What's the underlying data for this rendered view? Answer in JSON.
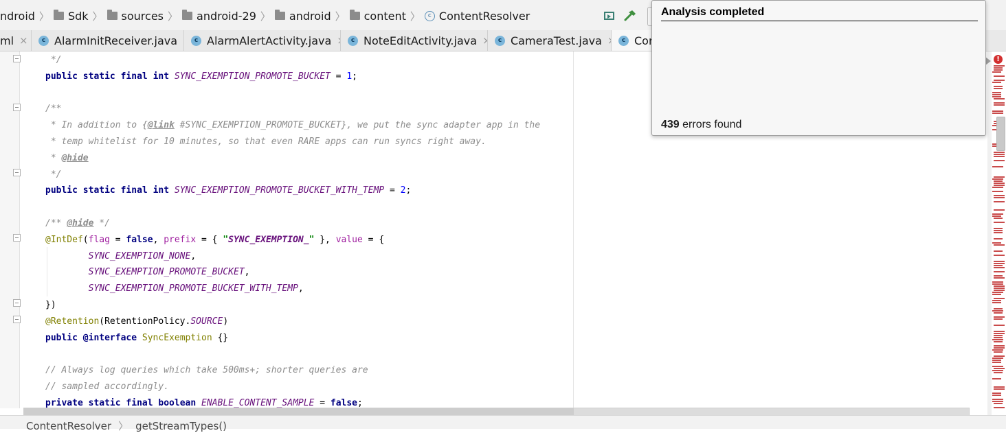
{
  "navbar": {
    "breadcrumbs": [
      {
        "label": "ndroid",
        "icon": "none"
      },
      {
        "label": "Sdk",
        "icon": "folder-icon"
      },
      {
        "label": "sources",
        "icon": "folder-icon"
      },
      {
        "label": "android-29",
        "icon": "folder-icon"
      },
      {
        "label": "android",
        "icon": "folder-icon"
      },
      {
        "label": "content",
        "icon": "folder-icon"
      },
      {
        "label": "ContentResolver",
        "icon": "class-icon"
      }
    ],
    "separator": "〉"
  },
  "tabs": [
    {
      "label": "ml",
      "close": "×",
      "icon": "none",
      "active": false
    },
    {
      "label": "AlarmInitReceiver.java",
      "close": "×",
      "icon": "class-icon",
      "active": false
    },
    {
      "label": "AlarmAlertActivity.java",
      "close": "×",
      "icon": "class-icon",
      "active": false
    },
    {
      "label": "NoteEditActivity.java",
      "close": "×",
      "icon": "class-icon",
      "active": false
    },
    {
      "label": "CameraTest.java",
      "close": "×",
      "icon": "class-icon",
      "active": false
    },
    {
      "label": "Cor",
      "close": "",
      "icon": "class-icon",
      "active": true
    }
  ],
  "code_lines": [
    " */",
    "public static final int SYNC_EXEMPTION_PROMOTE_BUCKET = 1;",
    "",
    "/**",
    " * In addition to {@link #SYNC_EXEMPTION_PROMOTE_BUCKET}, we put the sync adapter app in the",
    " * temp whitelist for 10 minutes, so that even RARE apps can run syncs right away.",
    " * @hide",
    " */",
    "public static final int SYNC_EXEMPTION_PROMOTE_BUCKET_WITH_TEMP = 2;",
    "",
    "/** @hide */",
    "@IntDef(flag = false, prefix = { \"SYNC_EXEMPTION_\" }, value = {",
    "        SYNC_EXEMPTION_NONE,",
    "        SYNC_EXEMPTION_PROMOTE_BUCKET,",
    "        SYNC_EXEMPTION_PROMOTE_BUCKET_WITH_TEMP,",
    "})",
    "@Retention(RetentionPolicy.SOURCE)",
    "public @interface SyncExemption {}",
    "",
    "// Always log queries which take 500ms+; shorter queries are",
    "// sampled accordingly.",
    "private static final boolean ENABLE_CONTENT_SAMPLE = false;"
  ],
  "status_bar": {
    "items": [
      "ContentResolver",
      "getStreamTypes()"
    ],
    "separator": "〉"
  },
  "popup": {
    "title": "Analysis completed",
    "error_count": "439",
    "error_suffix": " errors found"
  },
  "icons": {
    "toolbar": [
      "run-config-icon",
      "build-hammer-icon"
    ],
    "error_indicator": "!"
  },
  "colors": {
    "error_marker": "#c94b4b",
    "keyword": "#000080",
    "constant": "#660e7a",
    "annotation": "#808000",
    "string": "#008000",
    "number": "#0000ff",
    "comment": "#8c8c8c"
  }
}
